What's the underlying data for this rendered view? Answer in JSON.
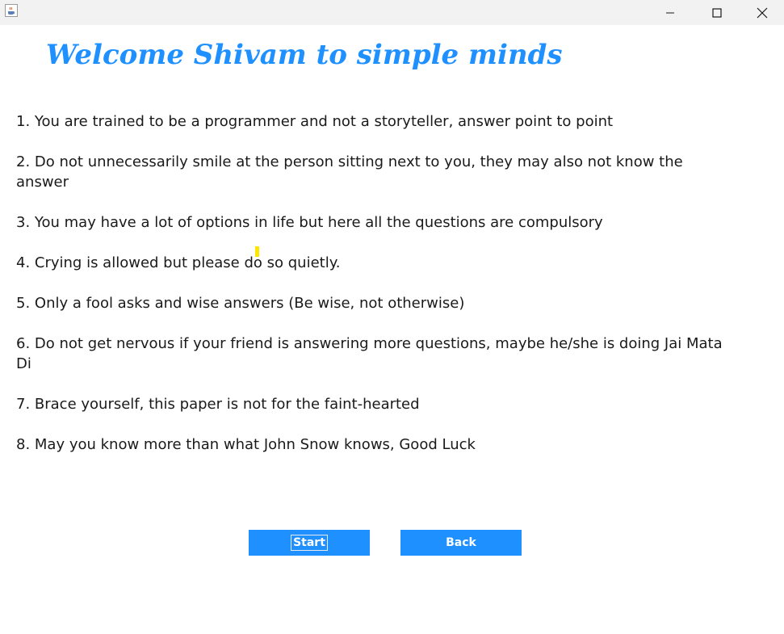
{
  "titlebar": {
    "app_icon": "java-coffee-icon",
    "minimize_icon": "minimize-icon",
    "maximize_icon": "maximize-icon",
    "close_icon": "close-icon"
  },
  "heading": "Welcome Shivam to simple minds",
  "rules": [
    "1. You are trained to be a programmer and not a storyteller, answer point to point",
    "2. Do not unnecessarily smile at the person sitting next to you, they may also not know the answer",
    "3. You may have a lot of options in life but here all the questions are compulsory",
    "4. Crying is allowed but please do so quietly.",
    "5. Only a fool asks and wise answers (Be wise, not otherwise)",
    "6. Do not get nervous if your friend is answering more questions, maybe he/she is doing Jai Mata Di",
    "7. Brace yourself, this paper is not for the faint-hearted",
    "8. May you know more than what John Snow knows, Good Luck"
  ],
  "buttons": {
    "start_label": "Start",
    "back_label": "Back"
  },
  "colors": {
    "accent": "#1e90ff",
    "text": "#1a1a1a",
    "titlebar_bg": "#f2f2f2",
    "caret_highlight": "#ffe600"
  }
}
